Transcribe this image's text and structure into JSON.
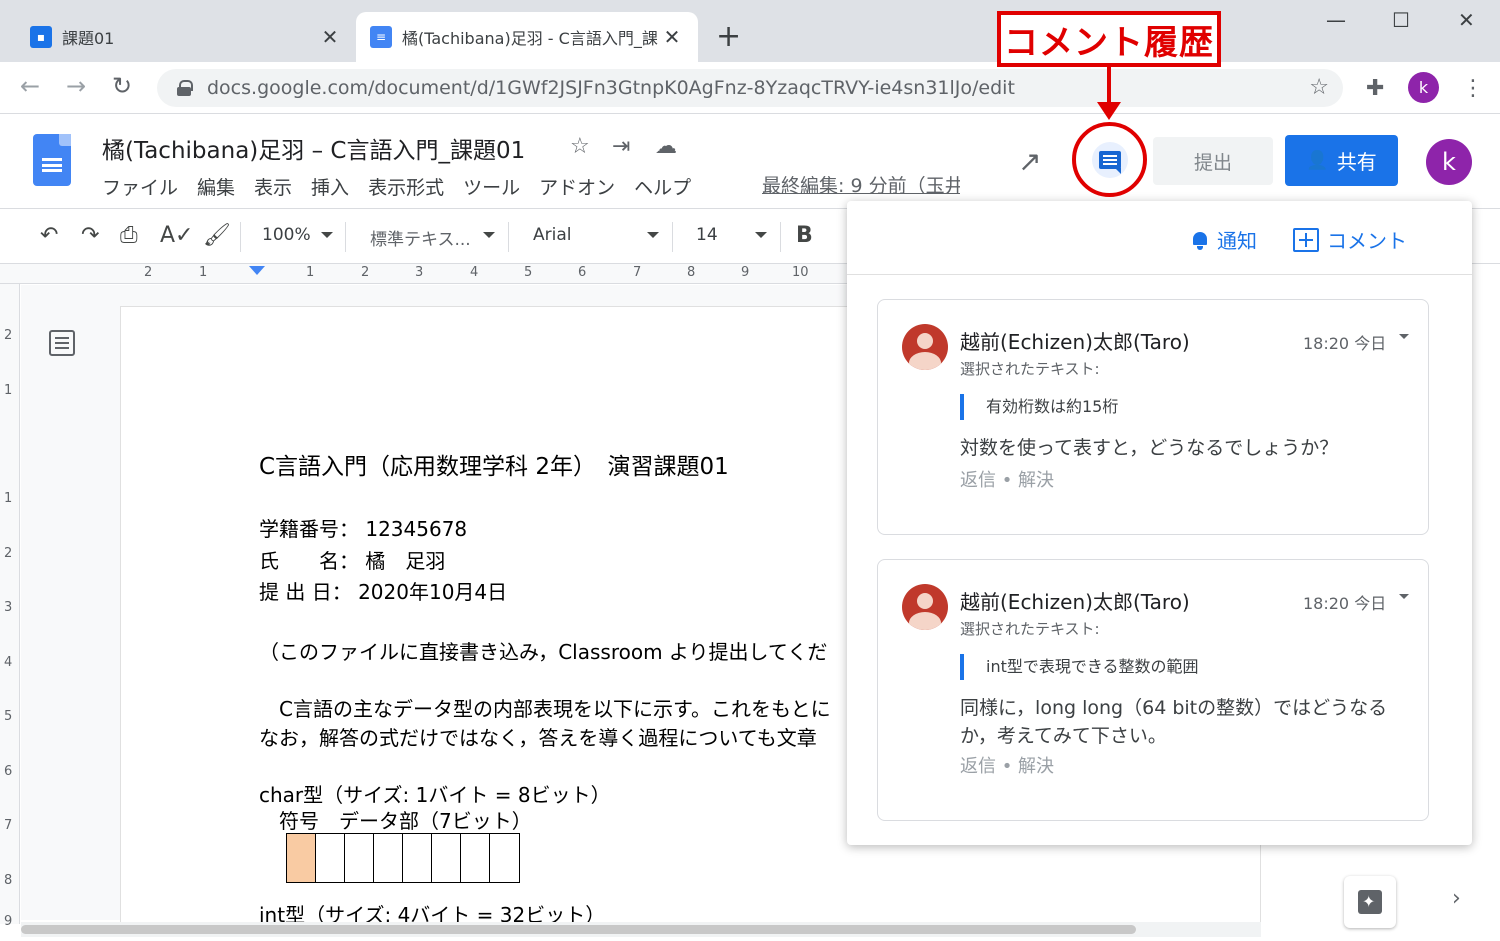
{
  "browser": {
    "tabs": [
      {
        "title": "課題01",
        "close": "✕"
      },
      {
        "title": "橘(Tachibana)足羽 - C言語入門_課",
        "close": "✕"
      }
    ],
    "new_tab": "+",
    "window_controls": {
      "minimize": "—",
      "maximize": "☐",
      "close": "✕"
    },
    "url": "docs.google.com/document/d/1GWf2JSJFn3GtnpK0AgFnz-8YzaqcTRVY-ie4sn31lJo/edit",
    "profile_initial": "k"
  },
  "annotation": {
    "label": "コメント履歴",
    "color": "#e00000"
  },
  "docs": {
    "title": "橘(Tachibana)足羽 – C言語入門_課題01",
    "menus": [
      "ファイル",
      "編集",
      "表示",
      "挿入",
      "表示形式",
      "ツール",
      "アドオン",
      "ヘルプ"
    ],
    "last_edit": "最終編集: 9 分前（玉井",
    "submit_label": "提出",
    "share_label": "共有",
    "profile_initial": "k",
    "accent": "#1a73e8"
  },
  "edit_toolbar": {
    "zoom": "100%",
    "style": "標準テキス...",
    "font": "Arial",
    "size": "14",
    "bold": "B"
  },
  "ruler": {
    "h_labels": [
      "2",
      "1",
      "1",
      "2",
      "3",
      "4",
      "5",
      "6",
      "7",
      "8",
      "9",
      "10"
    ],
    "v_labels": [
      "2",
      "1",
      "1",
      "2",
      "3",
      "4",
      "5",
      "6",
      "7",
      "8",
      "9"
    ]
  },
  "document": {
    "heading": "C言語入門（応用数理学科 2年）　演習課題01",
    "student_id": "学籍番号：  12345678",
    "name": "氏　　名：  橘　足羽",
    "date": "提  出  日：  2020年10月4日",
    "note": "（このファイルに直接書き込み，Classroom より提出してくだ",
    "para1": "　C言語の主なデータ型の内部表現を以下に示す。これをもとに",
    "para2": "なお，解答の式だけではなく，答えを導く過程についても文章",
    "char_type": "char型（サイズ: 1バイト = 8ビット）",
    "char_parts": "　符号　データ部（7ビット）",
    "int_type": "int型（サイズ: 4バイト = 32ビット）",
    "bit_count": 8,
    "sign_color": "#f9cba3"
  },
  "comments_panel": {
    "notify_label": "通知",
    "comment_label": "コメント",
    "comments": [
      {
        "author": "越前(Echizen)太郎(Taro)",
        "time": "18:20 今日",
        "selected_label": "選択されたテキスト:",
        "quote": "有効桁数は約15桁",
        "body": "対数を使って表すと，どうなるでしょうか？",
        "actions": "返信 • 解決"
      },
      {
        "author": "越前(Echizen)太郎(Taro)",
        "time": "18:20 今日",
        "selected_label": "選択されたテキスト:",
        "quote": "int型で表現できる整数の範囲",
        "body": "同様に，long long（64 bitの整数）ではどうなるか，考えてみて下さい。",
        "actions": "返信 • 解決"
      }
    ]
  }
}
